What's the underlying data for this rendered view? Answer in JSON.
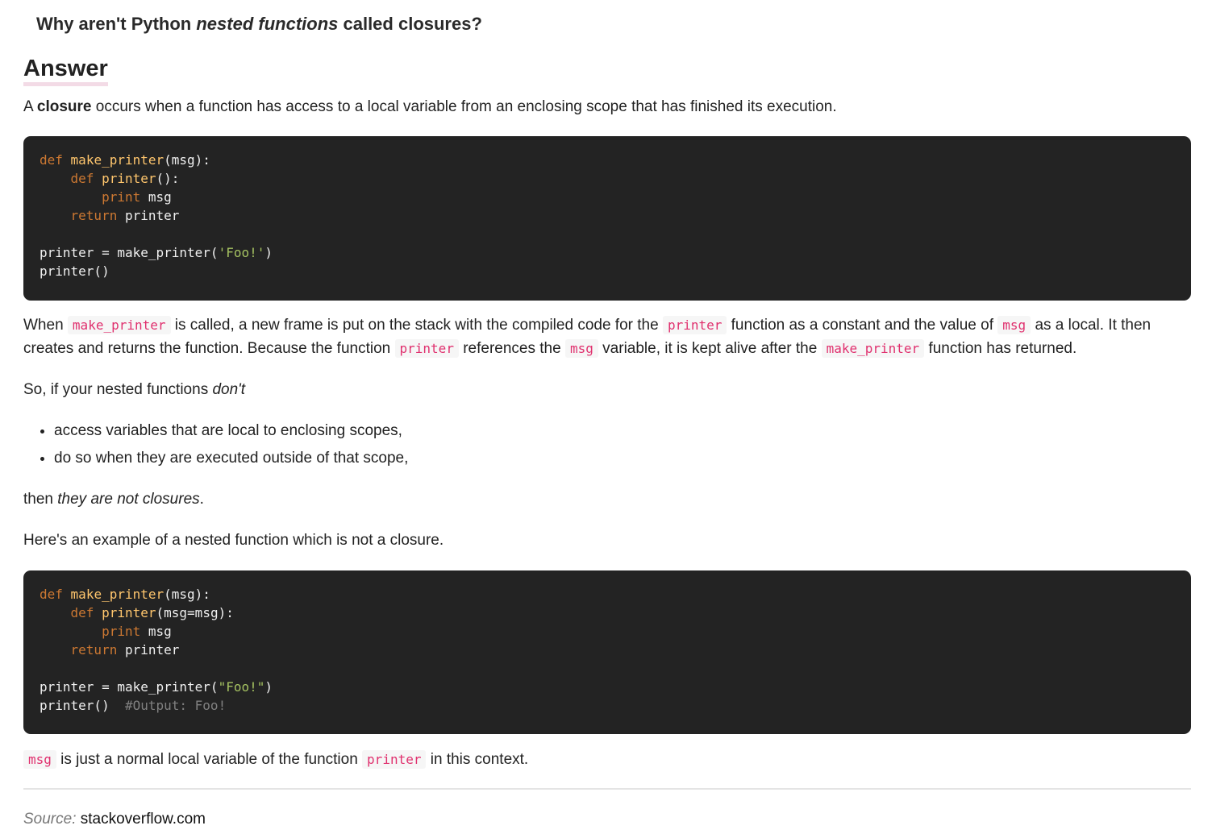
{
  "question": {
    "part1": "Why aren't Python ",
    "part2": "nested functions",
    "part3": " called closures?"
  },
  "answer_heading": "Answer",
  "intro": {
    "t1": "A ",
    "bold": "closure",
    "t2": " occurs when a function has access to a local variable from an enclosing scope that has finished its execution."
  },
  "code1": {
    "l1_kw": "def",
    "l1_fn": "make_printer",
    "l1_rest": "(msg):",
    "l2_kw": "def",
    "l2_fn": "printer",
    "l2_rest": "():",
    "l3_kw": "print",
    "l3_rest": " msg",
    "l4_kw": "return",
    "l4_rest": " printer",
    "l6_a": "printer = make_printer(",
    "l6_str": "'Foo!'",
    "l6_b": ")",
    "l7": "printer()"
  },
  "explain": {
    "t1": "When ",
    "c1": "make_printer",
    "t2": " is called, a new frame is put on the stack with the compiled code for the ",
    "c2": "printer",
    "t3": " function as a constant and the value of ",
    "c3": "msg",
    "t4": " as a local. It then creates and returns the function. Because the function ",
    "c4": "printer",
    "t5": " references the ",
    "c5": "msg",
    "t6": " variable, it is kept alive after the ",
    "c6": "make_printer",
    "t7": " function has returned."
  },
  "so_line": {
    "t1": "So, if your nested functions ",
    "em": "don't"
  },
  "bullets": [
    "access variables that are local to enclosing scopes,",
    "do so when they are executed outside of that scope,"
  ],
  "then_line": {
    "t1": "then ",
    "em": "they are not closures",
    "t2": "."
  },
  "example_intro": "Here's an example of a nested function which is not a closure.",
  "code2": {
    "l1_kw": "def",
    "l1_fn": "make_printer",
    "l1_rest": "(msg):",
    "l2_kw": "def",
    "l2_fn": "printer",
    "l2_rest": "(msg=msg):",
    "l3_kw": "print",
    "l3_rest": " msg",
    "l4_kw": "return",
    "l4_rest": " printer",
    "l6_a": "printer = make_printer(",
    "l6_str": "\"Foo!\"",
    "l6_b": ")",
    "l7_a": "printer()  ",
    "l7_cm": "#Output: Foo!"
  },
  "final": {
    "c1": "msg",
    "t1": " is just a normal local variable of the function ",
    "c2": "printer",
    "t2": " in this context."
  },
  "source": {
    "label": "Source:",
    "site": "stackoverflow.com"
  },
  "colors": {
    "inline_code": "#e0306e",
    "code_bg": "#232323",
    "keyword": "#cc7832",
    "function": "#ffc66d",
    "string": "#a5c261",
    "comment": "#808080",
    "heading_underline": "#f3dbe6"
  }
}
